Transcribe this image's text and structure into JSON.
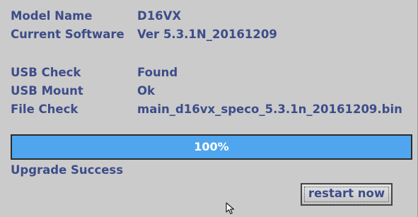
{
  "info": {
    "model_label": "Model Name",
    "model_value": "D16VX",
    "software_label": "Current Software",
    "software_value": "Ver 5.3.1N_20161209",
    "usb_check_label": "USB Check",
    "usb_check_value": "Found",
    "usb_mount_label": "USB Mount",
    "usb_mount_value": "Ok",
    "file_check_label": "File Check",
    "file_check_value": "main_d16vx_speco_5.3.1n_20161209.bin"
  },
  "progress": {
    "percent": 100,
    "text": "100%",
    "fill_color": "#4fa6ee"
  },
  "status": {
    "text": "Upgrade Success"
  },
  "actions": {
    "restart_label": "restart now"
  },
  "cursor_icon": "mouse-pointer-icon"
}
